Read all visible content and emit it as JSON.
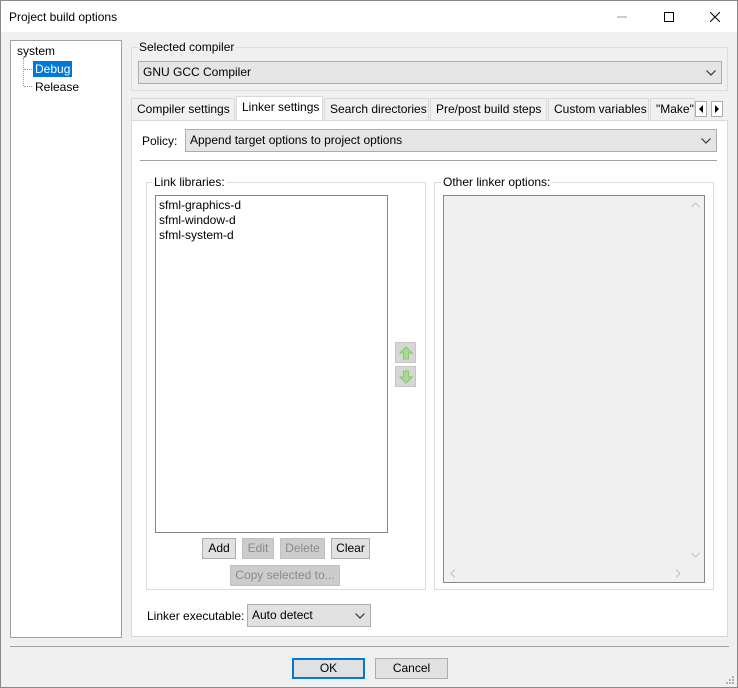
{
  "window": {
    "title": "Project build options",
    "minimize_label": "—",
    "maximize_label": "☐",
    "close_label": "✕"
  },
  "tree": {
    "root": "system",
    "children": [
      "Debug",
      "Release"
    ],
    "selected": "Debug"
  },
  "compiler": {
    "label": "Selected compiler",
    "value": "GNU GCC Compiler"
  },
  "tabs": [
    {
      "label": "Compiler settings"
    },
    {
      "label": "Linker settings",
      "active": true
    },
    {
      "label": "Search directories"
    },
    {
      "label": "Pre/post build steps"
    },
    {
      "label": "Custom variables"
    },
    {
      "label": "\"Make\""
    }
  ],
  "policy": {
    "label": "Policy:",
    "value": "Append target options to project options"
  },
  "link_libraries": {
    "label": "Link libraries:",
    "items": [
      "sfml-graphics-d",
      "sfml-window-d",
      "sfml-system-d"
    ],
    "buttons": {
      "add": "Add",
      "edit": "Edit",
      "delete": "Delete",
      "clear": "Clear",
      "copy": "Copy selected to..."
    }
  },
  "other_options": {
    "label": "Other linker options:",
    "value": ""
  },
  "linker_exe": {
    "label": "Linker executable:",
    "value": "Auto detect"
  },
  "dialog_buttons": {
    "ok": "OK",
    "cancel": "Cancel"
  },
  "colors": {
    "selection": "#0078d7",
    "arrow_green": "#86c866"
  },
  "icons": [
    "minimize-icon",
    "maximize-icon",
    "close-icon",
    "chevron-down-icon",
    "chevron-left-icon",
    "chevron-right-icon",
    "arrow-up-icon",
    "arrow-down-icon"
  ]
}
